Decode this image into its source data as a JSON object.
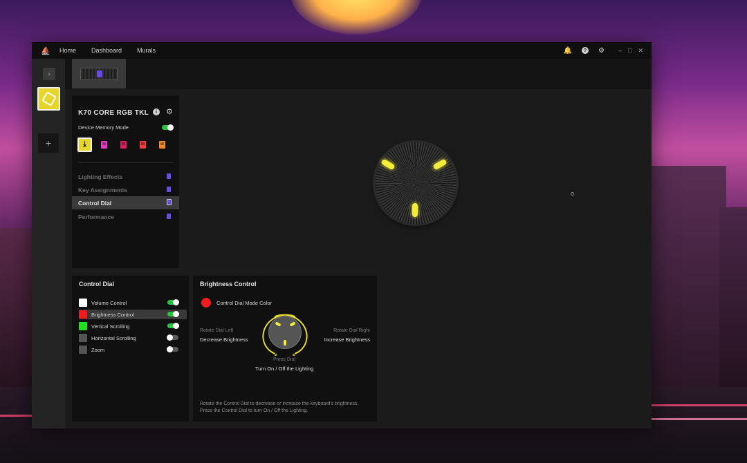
{
  "titlebar": {
    "nav": [
      "Home",
      "Dashboard",
      "Murals"
    ],
    "icons": [
      "bell-icon",
      "help-icon",
      "gear-icon"
    ],
    "window_controls": [
      "–",
      "□",
      "✕"
    ]
  },
  "device": {
    "name": "K70 CORE RGB TKL",
    "memory_mode_label": "Device Memory Mode",
    "memory_mode_on": true,
    "profiles": [
      {
        "color": "#e6d52a",
        "active": true
      },
      {
        "color": "#e23cc6",
        "active": false
      },
      {
        "color": "#d81e63",
        "active": false
      },
      {
        "color": "#ee3a3a",
        "active": false
      },
      {
        "color": "#ef8a2a",
        "active": false
      }
    ],
    "menu": [
      {
        "label": "Lighting Effects",
        "selected": false
      },
      {
        "label": "Key Assignments",
        "selected": false
      },
      {
        "label": "Control Dial",
        "selected": true
      },
      {
        "label": "Performance",
        "selected": false
      }
    ]
  },
  "control_dial": {
    "title": "Control Dial",
    "modes": [
      {
        "label": "Volume Control",
        "color": "#ffffff",
        "enabled": true,
        "selected": false
      },
      {
        "label": "Brightness Control",
        "color": "#ee1c1c",
        "enabled": true,
        "selected": true
      },
      {
        "label": "Vertical Scrolling",
        "color": "#22dd22",
        "enabled": true,
        "selected": false
      },
      {
        "label": "Horizontal Scrolling",
        "color": "#555555",
        "enabled": false,
        "selected": false
      },
      {
        "label": "Zoom",
        "color": "#555555",
        "enabled": false,
        "selected": false
      }
    ]
  },
  "brightness": {
    "title": "Brightness Control",
    "mode_color_label": "Control Dial Mode Color",
    "mode_color": "#ee1c1c",
    "left_hint": "Rotate Dial Left",
    "left_action": "Decrease Brightness",
    "right_hint": "Rotate Dial Right",
    "right_action": "Increase Brightness",
    "press_hint": "Press Dial",
    "press_action": "Turn On / Off the Lighting",
    "description": "Rotate the Control Dial to decrease or increase the keyboard's brightness. Press the Control Dial to turn On / Off the Lighting."
  },
  "colors": {
    "accent_yellow": "#e6d52a",
    "toggle_on": "#27c43b",
    "led": "#f4ee3a"
  }
}
